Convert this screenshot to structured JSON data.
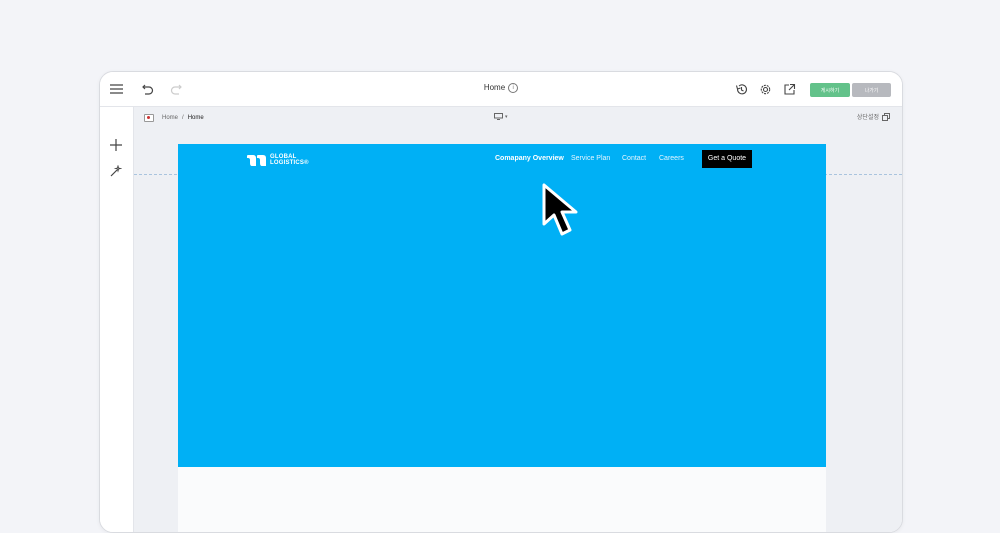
{
  "toolbar": {
    "title": "Home",
    "save_label": "게시하기",
    "exit_label": "나가기"
  },
  "icons": [
    "menu-icon",
    "undo-icon",
    "redo-icon",
    "history-icon",
    "gear-icon",
    "external-link-icon",
    "plus-icon",
    "magic-wand-icon",
    "desktop-icon",
    "copy-icon",
    "info-icon",
    "flag-icon"
  ],
  "breadcrumb": {
    "root": "Home",
    "separator": "/",
    "current": "Home"
  },
  "device_selector": {
    "value": "desktop"
  },
  "header_settings": {
    "label": "상단설정"
  },
  "site": {
    "logo_line1": "GLOBAL",
    "logo_line2": "LOGISTICS",
    "logo_mark": "®",
    "nav": [
      "Comapany Overview",
      "Service Plan",
      "Contact",
      "Careers"
    ],
    "active_nav": "Comapany Overview",
    "cta": "Get a Quote",
    "hero_color": "#00B0F5"
  },
  "colors": {
    "save": "#63C28A",
    "exit": "#B7B9BE",
    "hero": "#00B0F5"
  }
}
